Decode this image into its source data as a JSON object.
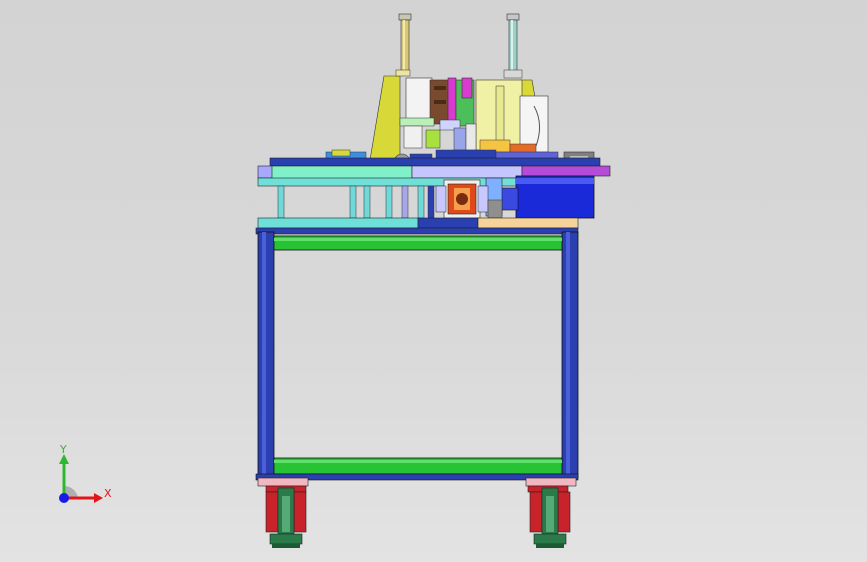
{
  "viewport": {
    "background_top": "#d3d3d3",
    "background_bottom": "#e3e3e3"
  },
  "triad": {
    "x_label": "X",
    "y_label": "Y",
    "x_color": "#e0161b",
    "y_color": "#2fb82f",
    "z_color": "#1a1ae6"
  },
  "colors": {
    "frame_blue": "#2a3fb0",
    "rail_green": "#27c334",
    "plate_cyan": "#6fe0d8",
    "yellow": "#d8d838",
    "magenta": "#d93ad0",
    "red": "#c8222a",
    "motor_blue": "#1a2ad8"
  }
}
